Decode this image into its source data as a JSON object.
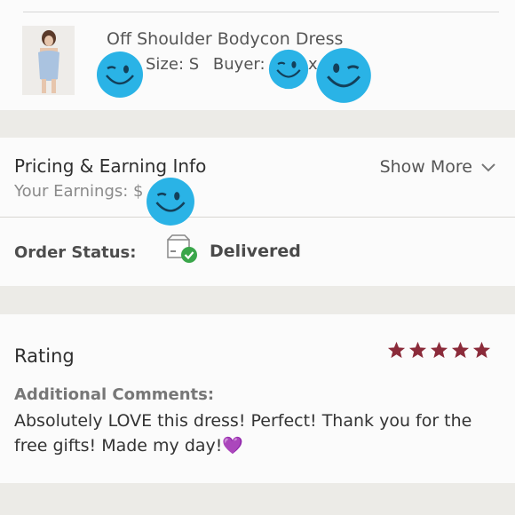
{
  "product": {
    "title": "Off Shoulder Bodycon Dress",
    "size": "Size: S",
    "buyer_label": "Buyer:",
    "buyer_partial": "x"
  },
  "pricing": {
    "title": "Pricing & Earning Info",
    "earnings_label": "Your Earnings: $",
    "show_more_label": "Show More"
  },
  "order_status": {
    "label": "Order Status:",
    "value": "Delivered"
  },
  "rating": {
    "title": "Rating",
    "stars": 5,
    "comments_label": "Additional Comments:",
    "comments": "Absolutely LOVE this dress! Perfect! Thank you for the free gifts! Made my day!💜"
  },
  "colors": {
    "star": "#8b2b3a",
    "smiley": "#2ab3e6",
    "check": "#3aa64a"
  },
  "icons": [
    "dress-photo",
    "winking-smiley-icon",
    "package-delivered-icon",
    "chevron-down-icon",
    "star-icon"
  ]
}
